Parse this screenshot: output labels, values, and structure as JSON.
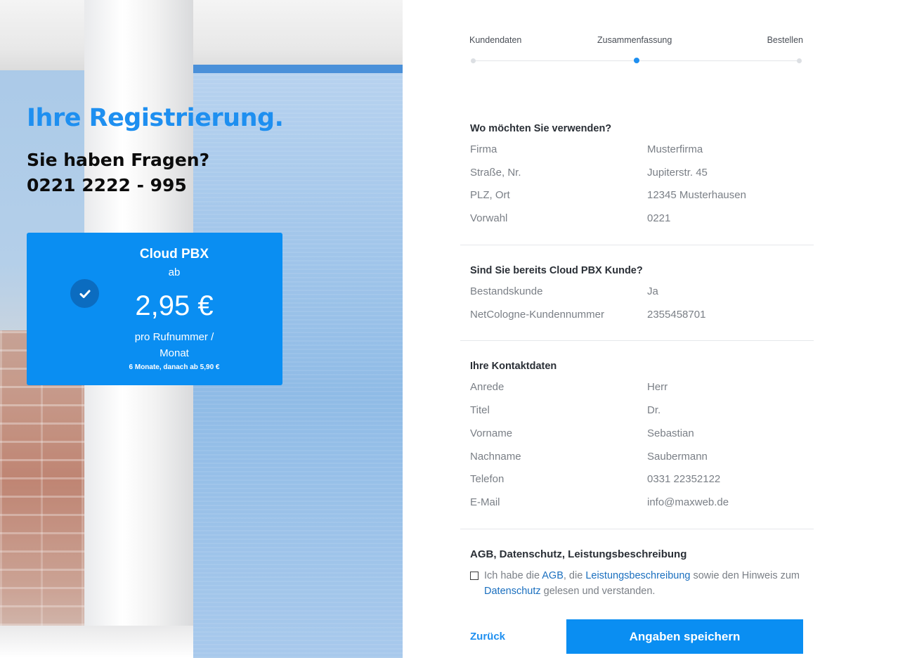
{
  "hero": {
    "title": "Ihre Registrierung.",
    "question": "Sie haben Fragen?",
    "phone": "0221 2222 - 995"
  },
  "product": {
    "name": "Cloud PBX",
    "from": "ab",
    "price": "2,95 €",
    "unit_line1": "pro Rufnummer /",
    "unit_line2": "Monat",
    "note": "6 Monate, danach ab 5,90 €",
    "selected": true
  },
  "stepper": {
    "steps": [
      "Kundendaten",
      "Zusammenfassung",
      "Bestellen"
    ],
    "active_index": 1
  },
  "sections": {
    "usage": {
      "title": "Wo möchten Sie verwenden?",
      "rows": [
        {
          "label": "Firma",
          "value": "Musterfirma"
        },
        {
          "label": "Straße, Nr.",
          "value": "Jupiterstr. 45"
        },
        {
          "label": "PLZ, Ort",
          "value": "12345 Musterhausen"
        },
        {
          "label": "Vorwahl",
          "value": "0221"
        }
      ]
    },
    "customer": {
      "title": "Sind Sie bereits Cloud PBX Kunde?",
      "rows": [
        {
          "label": "Bestandskunde",
          "value": "Ja"
        },
        {
          "label": "NetCologne-Kundennummer",
          "value": "2355458701"
        }
      ]
    },
    "contact": {
      "title": "Ihre Kontaktdaten",
      "rows": [
        {
          "label": "Anrede",
          "value": "Herr"
        },
        {
          "label": "Titel",
          "value": "Dr."
        },
        {
          "label": "Vorname",
          "value": "Sebastian"
        },
        {
          "label": "Nachname",
          "value": "Saubermann"
        },
        {
          "label": "Telefon",
          "value": "0331 22352122"
        },
        {
          "label": "E-Mail",
          "value": "info@maxweb.de"
        }
      ]
    }
  },
  "agb": {
    "title": "AGB, Datenschutz, Leistungsbeschreibung",
    "text_1": "Ich habe die ",
    "link_agb": "AGB",
    "text_2": ", die ",
    "link_leistung": "Leistungsbeschreibung",
    "text_3": " sowie den Hinweis zum ",
    "link_datenschutz": "Datenschutz",
    "text_4": " gelesen und verstanden.",
    "checked": false
  },
  "actions": {
    "back_label": "Zurück",
    "save_label": "Angaben speichern"
  },
  "colors": {
    "accent": "#0a8ef2",
    "title_blue": "#1e8ff0",
    "link_blue": "#1a6fbf"
  }
}
